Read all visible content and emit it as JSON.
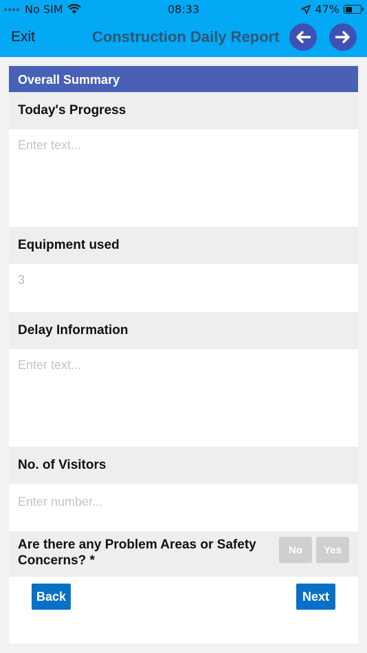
{
  "status_bar": {
    "carrier": "No SIM",
    "time": "08:33",
    "battery": "47%",
    "battery_level": 0.47
  },
  "nav": {
    "exit_label": "Exit",
    "title": "Construction Daily Report"
  },
  "form": {
    "section_title": "Overall Summary",
    "fields": [
      {
        "label": "Today's Progress",
        "placeholder": "Enter text..."
      },
      {
        "label": "Equipment used",
        "value": "3"
      },
      {
        "label": "Delay Information",
        "placeholder": "Enter text..."
      },
      {
        "label": "No. of Visitors",
        "placeholder": "Enter number..."
      }
    ],
    "question": {
      "text": "Are there any Problem Areas or Safety Concerns? *",
      "no_label": "No",
      "yes_label": "Yes"
    },
    "back_label": "Back",
    "next_label": "Next"
  },
  "colors": {
    "nav_background": "#03a9f4",
    "section_header": "#4861b7",
    "action_button": "#0a70c7",
    "circle_button": "#3f51b5"
  }
}
